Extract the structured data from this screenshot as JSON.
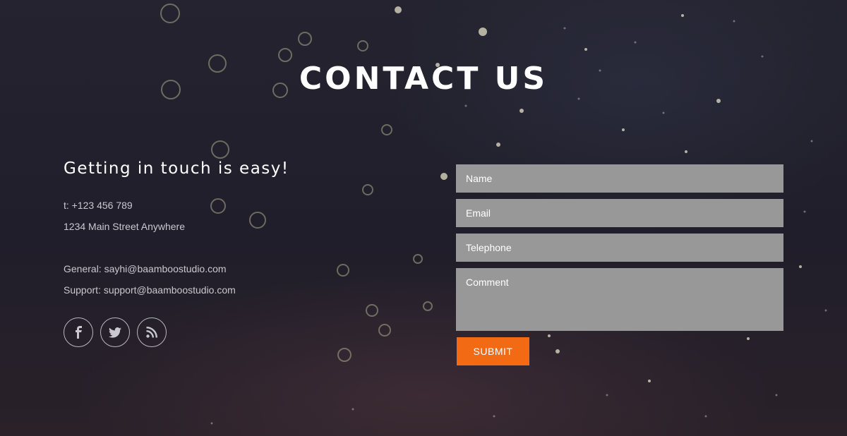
{
  "page": {
    "title": "CONTACT US"
  },
  "contact": {
    "tagline": "Getting in touch is easy!",
    "phone": "t: +123 456 789",
    "address": "1234 Main Street Anywhere",
    "general": "General: sayhi@baamboostudio.com",
    "support": "Support: support@baamboostudio.com"
  },
  "social": {
    "icons": [
      "facebook-icon",
      "twitter-icon",
      "rss-icon"
    ]
  },
  "form": {
    "name_placeholder": "Name",
    "email_placeholder": "Email",
    "telephone_placeholder": "Telephone",
    "comment_placeholder": "Comment",
    "submit_label": "SUBMIT"
  },
  "colors": {
    "accent": "#f26a14",
    "field": "#989898",
    "background": "#221f2c"
  }
}
